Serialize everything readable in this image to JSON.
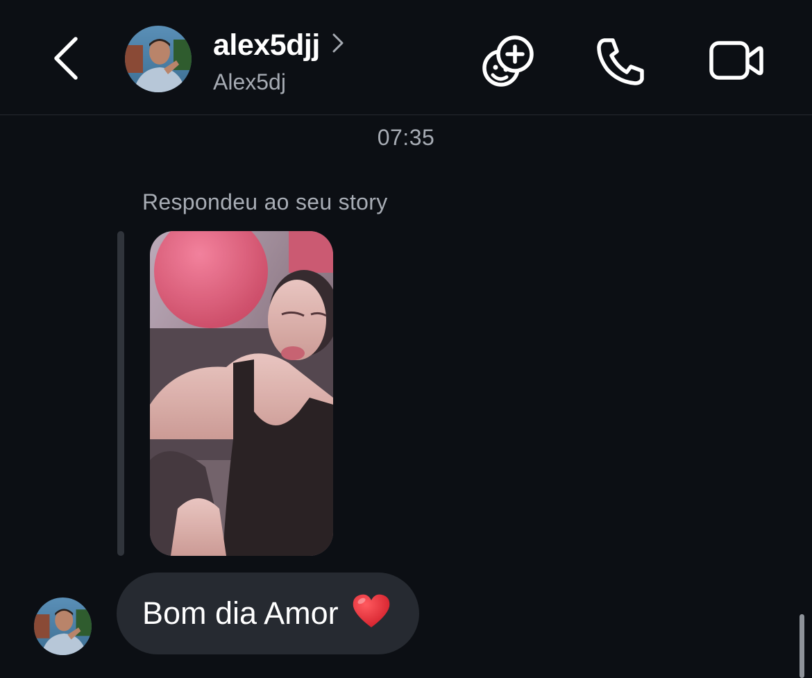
{
  "header": {
    "username": "alex5djj",
    "display_name": "Alex5dj",
    "icons": {
      "back": "chevron-left-icon",
      "username_chevron": "chevron-right-icon",
      "effects": "add-effects-icon",
      "call": "phone-icon",
      "video": "video-camera-icon"
    }
  },
  "conversation": {
    "timestamp": "07:35",
    "story_reply_label": "Respondeu ao seu story",
    "message": {
      "text": "Bom dia Amor",
      "emoji": "heart-emoji"
    }
  },
  "colors": {
    "background": "#0c0f14",
    "bubble": "#262a31",
    "secondary_text": "#a8adb5",
    "heart": "#e0242f"
  }
}
